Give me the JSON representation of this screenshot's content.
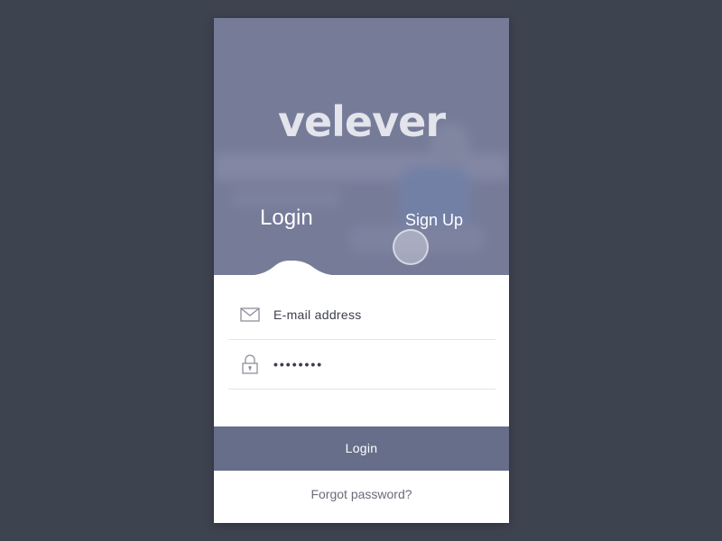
{
  "app": {
    "logo_text": "velever"
  },
  "tabs": {
    "login_label": "Login",
    "signup_label": "Sign Up"
  },
  "form": {
    "email": {
      "placeholder": "E-mail address",
      "value": "",
      "icon": "envelope-icon"
    },
    "password": {
      "placeholder": "",
      "value": "••••••••",
      "icon": "lock-icon"
    }
  },
  "actions": {
    "login_button_label": "Login",
    "forgot_password_label": "Forgot password?"
  },
  "colors": {
    "background": "#3e4350",
    "hero_overlay": "#767b98",
    "button": "#666e8a",
    "card": "#ffffff"
  }
}
